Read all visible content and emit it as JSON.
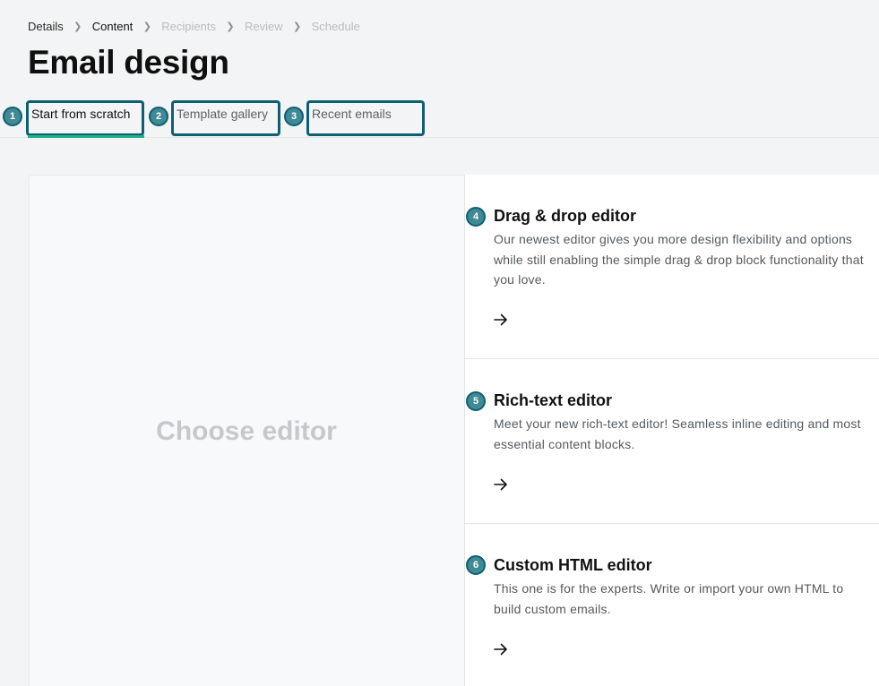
{
  "breadcrumb": {
    "steps": [
      {
        "label": "Details",
        "state": "done"
      },
      {
        "label": "Content",
        "state": "current"
      },
      {
        "label": "Recipients",
        "state": "upcoming"
      },
      {
        "label": "Review",
        "state": "upcoming"
      },
      {
        "label": "Schedule",
        "state": "upcoming"
      }
    ],
    "separator_icon": "chevron-right-icon"
  },
  "page": {
    "title": "Email design"
  },
  "tabs": {
    "items": [
      {
        "label": "Start from scratch",
        "badge": "1",
        "active": true
      },
      {
        "label": "Template gallery",
        "badge": "2",
        "active": false
      },
      {
        "label": "Recent emails",
        "badge": "3",
        "active": false
      }
    ]
  },
  "preview": {
    "label": "Choose editor"
  },
  "editors": {
    "items": [
      {
        "badge": "4",
        "title": "Drag & drop editor",
        "description": "Our newest editor gives you more design flexibility and options while still enabling the simple drag & drop block functionality that you love.",
        "icon": "arrow-right-icon"
      },
      {
        "badge": "5",
        "title": "Rich-text editor",
        "description": "Meet your new rich-text editor! Seamless inline editing and most essential content blocks.",
        "icon": "arrow-right-icon"
      },
      {
        "badge": "6",
        "title": "Custom HTML editor",
        "description": "This one is for the experts. Write or import your own HTML to build custom emails.",
        "icon": "arrow-right-icon"
      }
    ]
  },
  "colors": {
    "accent_underline": "#1eb383",
    "highlight_border": "#0f5f73",
    "badge_fill": "#3f8a94"
  }
}
